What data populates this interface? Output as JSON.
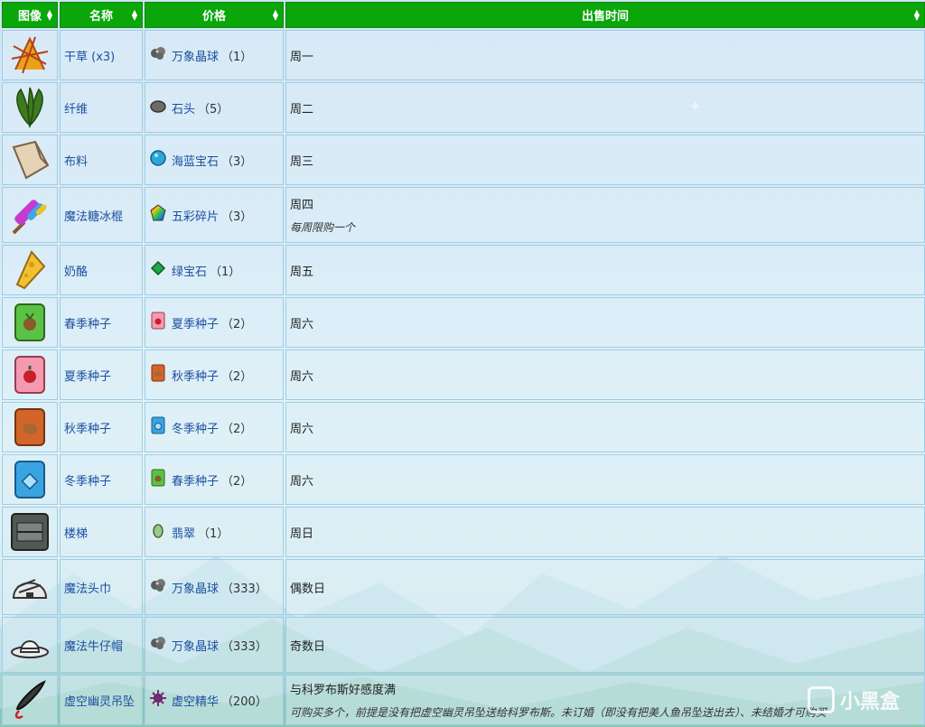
{
  "headers": {
    "image": "图像",
    "name": "名称",
    "price": "价格",
    "time": "出售时间"
  },
  "rows": [
    {
      "icon": "hay-icon",
      "name": "干草 (x3)",
      "price_icon": "prismatic-ore-icon",
      "price_name": "万象晶球",
      "price_qty": "（1）",
      "time": "周一",
      "note": ""
    },
    {
      "icon": "fiber-icon",
      "name": "纤维",
      "price_icon": "stone-icon",
      "price_name": "石头",
      "price_qty": "（5）",
      "time": "周二",
      "note": ""
    },
    {
      "icon": "cloth-icon",
      "name": "布料",
      "price_icon": "aquamarine-icon",
      "price_name": "海蓝宝石",
      "price_qty": "（3）",
      "time": "周三",
      "note": ""
    },
    {
      "icon": "rock-candy-icon",
      "name": "魔法糖冰棍",
      "price_icon": "prismatic-shard-icon",
      "price_name": "五彩碎片",
      "price_qty": "（3）",
      "time": "周四",
      "note": "每周限购一个"
    },
    {
      "icon": "cheese-icon",
      "name": "奶酪",
      "price_icon": "emerald-icon",
      "price_name": "绿宝石",
      "price_qty": "（1）",
      "time": "周五",
      "note": ""
    },
    {
      "icon": "spring-seeds-icon",
      "name": "春季种子",
      "price_icon": "summer-seeds-icon",
      "price_name": "夏季种子",
      "price_qty": "（2）",
      "time": "周六",
      "note": ""
    },
    {
      "icon": "summer-seeds-icon",
      "name": "夏季种子",
      "price_icon": "fall-seeds-icon",
      "price_name": "秋季种子",
      "price_qty": "（2）",
      "time": "周六",
      "note": ""
    },
    {
      "icon": "fall-seeds-icon",
      "name": "秋季种子",
      "price_icon": "winter-seeds-icon",
      "price_name": "冬季种子",
      "price_qty": "（2）",
      "time": "周六",
      "note": ""
    },
    {
      "icon": "winter-seeds-icon",
      "name": "冬季种子",
      "price_icon": "spring-seeds-icon",
      "price_name": "春季种子",
      "price_qty": "（2）",
      "time": "周六",
      "note": ""
    },
    {
      "icon": "staircase-icon",
      "name": "楼梯",
      "price_icon": "jade-icon",
      "price_name": "翡翠",
      "price_qty": "（1）",
      "time": "周日",
      "note": ""
    },
    {
      "icon": "magic-turban-icon",
      "name": "魔法头巾",
      "price_icon": "prismatic-ore-icon",
      "price_name": "万象晶球",
      "price_qty": "（333）",
      "time": "偶数日",
      "note": ""
    },
    {
      "icon": "magic-cowboy-hat-icon",
      "name": "魔法牛仔帽",
      "price_icon": "prismatic-ore-icon",
      "price_name": "万象晶球",
      "price_qty": "（333）",
      "time": "奇数日",
      "note": ""
    },
    {
      "icon": "void-ghost-pendant-icon",
      "name": "虚空幽灵吊坠",
      "price_icon": "void-essence-icon",
      "price_name": "虚空精华",
      "price_qty": "（200）",
      "time": "与科罗布斯好感度满",
      "note": "可购买多个，前提是没有把虚空幽灵吊坠送给科罗布斯。未订婚（即没有把美人鱼吊坠送出去）、未结婚才可购买"
    }
  ],
  "watermark": "小黑盒",
  "colors": {
    "header_bg": "#0aa60a",
    "link": "#1b4fa0",
    "cell_border": "#9fcce8"
  }
}
